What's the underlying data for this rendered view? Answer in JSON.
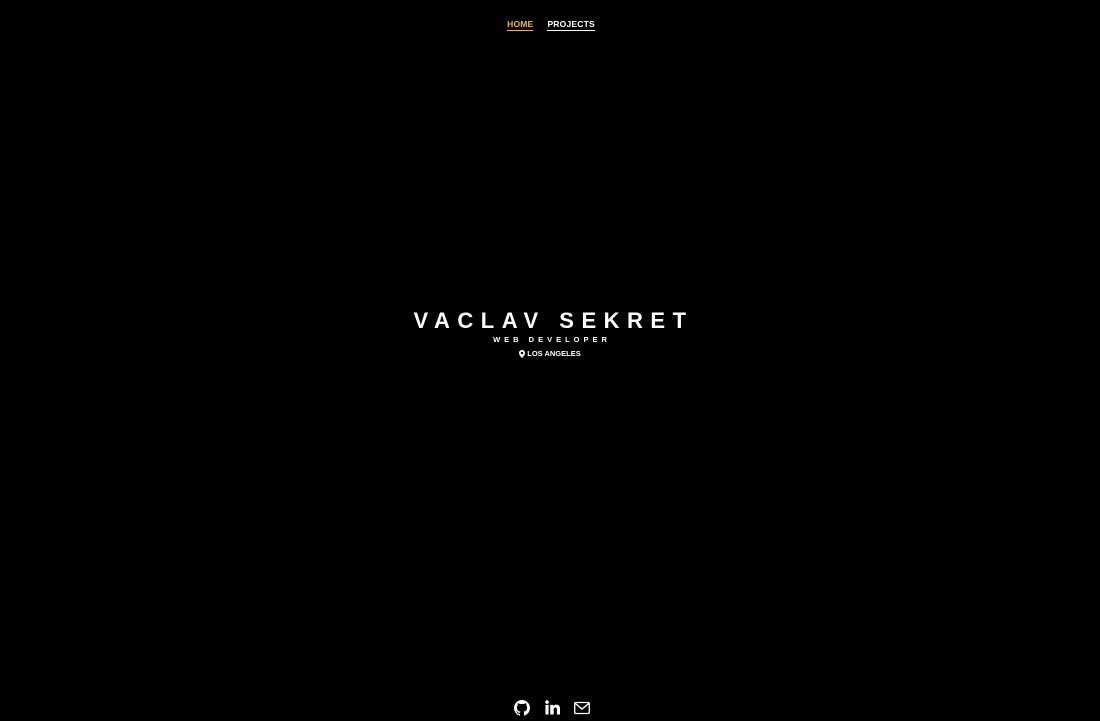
{
  "nav": {
    "items": [
      {
        "label": "HOME",
        "active": true
      },
      {
        "label": "PROJECTS",
        "active": false
      }
    ],
    "active_color": "#e8b84a"
  },
  "hero": {
    "name": "VACLAV SEKRET",
    "role": "WEB DEVELOPER",
    "location": "LOS ANGELES",
    "location_icon": "map-pin-icon"
  },
  "social": {
    "icons": [
      "github-icon",
      "linkedin-icon",
      "mail-icon"
    ]
  },
  "colors": {
    "background": "#000000",
    "text": "#ffffff",
    "accent": "#e8b84a"
  }
}
